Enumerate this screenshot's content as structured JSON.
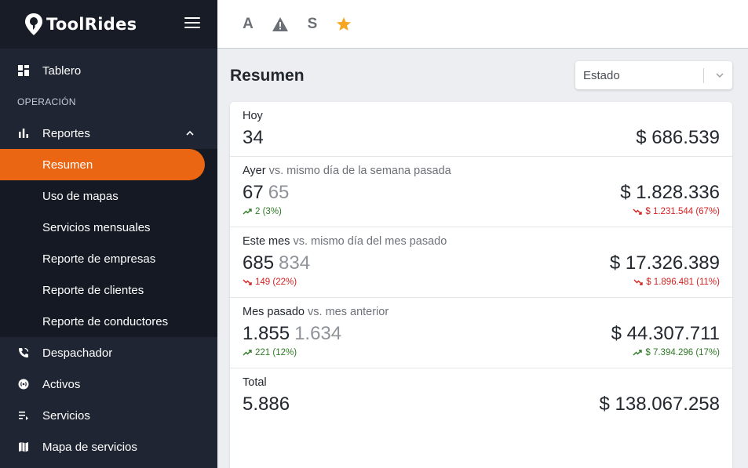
{
  "brand": {
    "name": "ToolRides"
  },
  "sidebar": {
    "items_top": [
      {
        "label": "Tablero",
        "icon": "dashboard-icon"
      }
    ],
    "section_label": "OPERACIÓN",
    "reportes": {
      "label": "Reportes",
      "icon": "bar-chart-icon",
      "children": [
        {
          "label": "Resumen",
          "active": true
        },
        {
          "label": "Uso de mapas"
        },
        {
          "label": "Servicios mensuales"
        },
        {
          "label": "Reporte de empresas"
        },
        {
          "label": "Reporte de clientes"
        },
        {
          "label": "Reporte de conductores"
        }
      ]
    },
    "items_bottom": [
      {
        "label": "Despachador",
        "icon": "phone-icon"
      },
      {
        "label": "Activos",
        "icon": "radio-icon"
      },
      {
        "label": "Servicios",
        "icon": "list-icon"
      },
      {
        "label": "Mapa de servicios",
        "icon": "map-icon"
      }
    ]
  },
  "topbar": {
    "icons": [
      {
        "label": "A",
        "icon": "letter-a-icon"
      },
      {
        "label": "",
        "icon": "warning-icon"
      },
      {
        "label": "S",
        "icon": "letter-s-icon"
      },
      {
        "label": "",
        "icon": "star-icon"
      }
    ]
  },
  "main": {
    "title": "Resumen",
    "filter": {
      "placeholder": "Estado"
    }
  },
  "summary": {
    "today": {
      "label": "Hoy",
      "count": "34",
      "amount": "$ 686.539"
    },
    "yesterday": {
      "label": "Ayer",
      "compare": "vs. mismo día de la semana pasada",
      "count": "67",
      "prev_count": "65",
      "amount": "$ 1.828.336",
      "count_delta": "2 (3%)",
      "amount_delta": "$ 1.231.544 (67%)"
    },
    "this_month": {
      "label": "Este mes",
      "compare": "vs. mismo día del mes pasado",
      "count": "685",
      "prev_count": "834",
      "amount": "$ 17.326.389",
      "count_delta": "149 (22%)",
      "amount_delta": "$ 1.896.481 (11%)"
    },
    "last_month": {
      "label": "Mes pasado",
      "compare": "vs. mes anterior",
      "count": "1.855",
      "prev_count": "1.634",
      "amount": "$ 44.307.711",
      "count_delta": "221 (12%)",
      "amount_delta": "$ 7.394.296 (17%)"
    },
    "total": {
      "label": "Total",
      "count": "5.886",
      "amount": "$ 138.067.258"
    }
  },
  "colors": {
    "accent": "#ea6612",
    "sidebar": "#1f2532",
    "up": "#2d7a24",
    "down": "#d51f1f",
    "star": "#f5a623"
  }
}
